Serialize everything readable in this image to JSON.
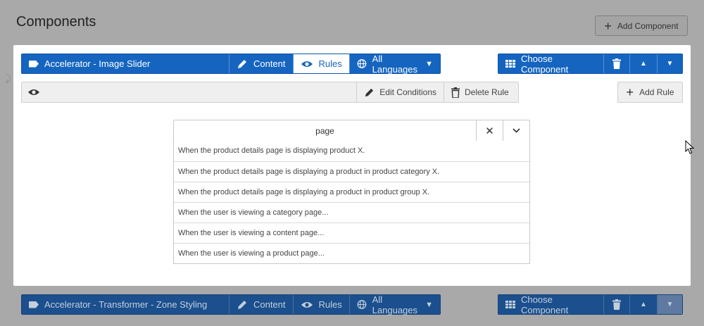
{
  "page": {
    "title": "Components",
    "add_component_label": "Add Component"
  },
  "component1": {
    "name": "Accelerator - Image Slider",
    "tabs": {
      "content": "Content",
      "rules": "Rules",
      "languages": "All Languages"
    },
    "active_tab": "rules",
    "choose_label": "Choose Component"
  },
  "rule_toolbar": {
    "edit_conditions": "Edit Conditions",
    "delete_rule": "Delete Rule",
    "add_rule": "Add Rule"
  },
  "search": {
    "value": "page",
    "options": [
      "When the product details page is displaying product X.",
      "When the product details page is displaying a product in product category X.",
      "When the product details page is displaying a product in product group X.",
      "When the user is viewing a category page...",
      "When the user is viewing a content page...",
      "When the user is viewing a product page..."
    ]
  },
  "component2": {
    "name": "Accelerator - Transformer - Zone Styling",
    "tabs": {
      "content": "Content",
      "rules": "Rules",
      "languages": "All Languages"
    },
    "choose_label": "Choose Component"
  },
  "icons": {
    "tag": "tag-icon",
    "pencil": "pencil-icon",
    "eye": "eye-icon",
    "globe": "globe-icon",
    "grid": "grid-icon",
    "trash": "trash-icon",
    "chevron_up": "chevron-up-icon",
    "chevron_down": "chevron-down-icon",
    "close": "close-icon",
    "plus": "plus-icon"
  },
  "colors": {
    "primary": "#1565c0",
    "overlay": "#a9a9a9",
    "panel": "#ffffff"
  }
}
